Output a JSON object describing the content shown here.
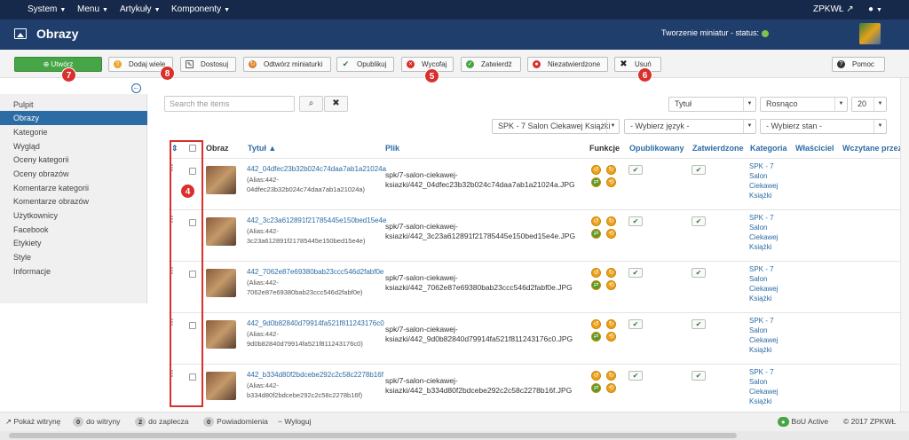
{
  "topbar": {
    "menus": [
      "System",
      "Menu",
      "Artykuły",
      "Komponenty"
    ],
    "site": "ZPKWŁ",
    "user_icon": "user-icon"
  },
  "header": {
    "title": "Obrazy",
    "status": "Tworzenie miniatur - status:",
    "status_color": "#7cc24f"
  },
  "toolbar": {
    "create": "Utwórz",
    "add_many": "Dodaj wiele",
    "adjust": "Dostosuj",
    "rebuild": "Odtwórz miniaturki",
    "publish": "Opublikuj",
    "unpublish": "Wycofaj",
    "approve": "Zatwierdź",
    "unapprove": "Niezatwierdzone",
    "delete": "Usuń",
    "help": "Pomoc"
  },
  "markers": {
    "create": "7",
    "add_many": "8",
    "unpublish": "5",
    "delete": "6",
    "checkboxes": "4"
  },
  "sidebar": {
    "items": [
      "Pulpit",
      "Obrazy",
      "Kategorie",
      "Wygląd",
      "Oceny kategorii",
      "Oceny obrazów",
      "Komentarze kategorii",
      "Komentarze obrazów",
      "Użytkownicy",
      "Facebook",
      "Etykiety",
      "Style",
      "Informacje"
    ]
  },
  "search": {
    "placeholder": "Search the items"
  },
  "filters": {
    "sort_field": "Tytuł",
    "sort_dir": "Rosnąco",
    "limit": "20",
    "category": "SPK - 7 Salon Ciekawej Książki",
    "language": "- Wybierz język -",
    "state": "- Wybierz stan -"
  },
  "columns": {
    "image": "Obraz",
    "title": "Tytuł",
    "file": "Plik",
    "functions": "Funkcje",
    "published": "Opublikowany",
    "approved": "Zatwierdzone",
    "category": "Kategoria",
    "owner": "Właściciel",
    "uploaded": "Wczytane przez"
  },
  "rows": [
    {
      "title": "442_04dfec23b32b024c74daa7ab1a21024a",
      "alias1": "(Alias:442-",
      "alias2": "04dfec23b32b024c74daa7ab1a21024a)",
      "path1": "spk/7-salon-ciekawej-",
      "path2": "ksiazki/442_04dfec23b32b024c74daa7ab1a21024a.JPG",
      "cat": [
        "SPK - 7",
        "Salon",
        "Ciekawej",
        "Książki"
      ]
    },
    {
      "title": "442_3c23a612891f21785445e150bed15e4e",
      "alias1": "(Alias:442-",
      "alias2": "3c23a612891f21785445e150bed15e4e)",
      "path1": "spk/7-salon-ciekawej-",
      "path2": "ksiazki/442_3c23a612891f21785445e150bed15e4e.JPG",
      "cat": [
        "SPK - 7",
        "Salon",
        "Ciekawej",
        "Książki"
      ]
    },
    {
      "title": "442_7062e87e69380bab23ccc546d2fabf0e",
      "alias1": "(Alias:442-",
      "alias2": "7062e87e69380bab23ccc546d2fabf0e)",
      "path1": "spk/7-salon-ciekawej-",
      "path2": "ksiazki/442_7062e87e69380bab23ccc546d2fabf0e.JPG",
      "cat": [
        "SPK - 7",
        "Salon",
        "Ciekawej",
        "Książki"
      ]
    },
    {
      "title": "442_9d0b82840d79914fa521f811243176c0",
      "alias1": "(Alias:442-",
      "alias2": "9d0b82840d79914fa521f811243176c0)",
      "path1": "spk/7-salon-ciekawej-",
      "path2": "ksiazki/442_9d0b82840d79914fa521f811243176c0.JPG",
      "cat": [
        "SPK - 7",
        "Salon",
        "Ciekawej",
        "Książki"
      ]
    },
    {
      "title": "442_b334d80f2bdcebe292c2c58c2278b16f",
      "alias1": "(Alias:442-",
      "alias2": "b334d80f2bdcebe292c2c58c2278b16f)",
      "path1": "spk/7-salon-ciekawej-",
      "path2": "ksiazki/442_b334d80f2bdcebe292c2c58c2278b16f.JPG",
      "cat": [
        "SPK - 7",
        "Salon",
        "Ciekawej",
        "Książki"
      ]
    }
  ],
  "footer": {
    "view_site": "Pokaż witrynę",
    "site_count": "0",
    "site_label": "do witryny",
    "admin_count": "2",
    "admin_label": "do zaplecza",
    "notif_count": "0",
    "notif_label": "Powiadomienia",
    "logout": "Wyloguj",
    "bou": "BoU Active",
    "copyright": "© 2017 ZPKWŁ"
  }
}
